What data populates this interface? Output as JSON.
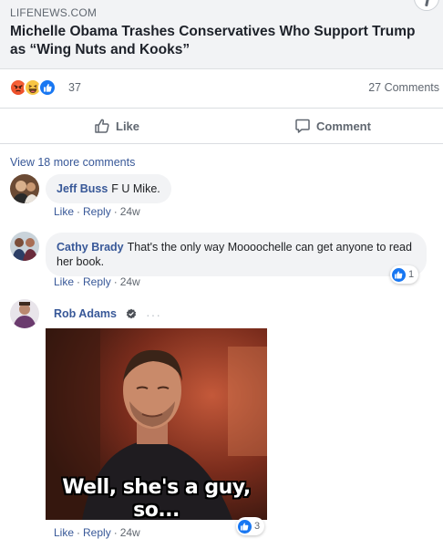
{
  "link": {
    "source": "LIFENEWS.COM",
    "title": "Michelle Obama Trashes Conservatives Who Support Trump as “Wing Nuts and Kooks”"
  },
  "stats": {
    "reaction_icons": [
      "angry-reaction-icon",
      "haha-reaction-icon",
      "like-reaction-icon"
    ],
    "reaction_count": "37",
    "comment_count": "27 Comments"
  },
  "actions": {
    "like_label": "Like",
    "comment_label": "Comment"
  },
  "view_more": "View 18 more comments",
  "comments": [
    {
      "author": "Jeff Buss",
      "text": "F U Mike.",
      "like": "Like",
      "reply": "Reply",
      "time": "24w"
    },
    {
      "author": "Cathy Brady",
      "text": "That's the only way Moooochelle can get anyone to read her book.",
      "like": "Like",
      "reply": "Reply",
      "time": "24w",
      "reactions": "1"
    },
    {
      "author": "Rob Adams",
      "more": "···",
      "gif_caption": "Well, she's a guy, so...",
      "like": "Like",
      "reply": "Reply",
      "time": "24w",
      "reactions": "3"
    }
  ],
  "colors": {
    "link_blue": "#385898",
    "like_blue": "#1877f2",
    "meta_gray": "#606770",
    "bubble_bg": "#f2f3f5"
  }
}
